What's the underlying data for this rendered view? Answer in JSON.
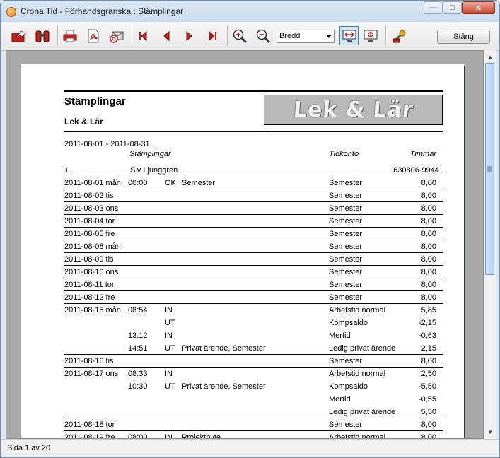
{
  "window": {
    "title": "Crona Tid - Förhandsgranska : Stämplingar"
  },
  "toolbar": {
    "zoom_value": "Bredd",
    "close_label": "Stäng"
  },
  "status": {
    "page_text": "Sida 1 av 20"
  },
  "colors": {
    "window_border": "#6f8fb4",
    "titlebar": "#c9dbef",
    "preview_bg": "#a8a8a8",
    "close_button": "#c9462c"
  },
  "report": {
    "title": "Stämplingar",
    "company": "Lek & Lär",
    "logo_text": "Lek & Lär",
    "period": "2011-08-01 - 2011-08-31",
    "headers": {
      "stamps": "Stämplingar",
      "account": "Tidkonto",
      "hours": "Timmar"
    },
    "employee": {
      "id": "1",
      "name": "Siv Ljunggren",
      "pnr": "630806-9944"
    },
    "rows": [
      {
        "date": "2011-08-01 mån",
        "time": "00:00",
        "type": "OK",
        "note": "Semester",
        "account": "Semester",
        "hours": "8,00",
        "line": true
      },
      {
        "date": "2011-08-02 tis",
        "time": "",
        "type": "",
        "note": "",
        "account": "Semester",
        "hours": "8,00",
        "line": true
      },
      {
        "date": "2011-08-03 ons",
        "time": "",
        "type": "",
        "note": "",
        "account": "Semester",
        "hours": "8,00",
        "line": true
      },
      {
        "date": "2011-08-04 tor",
        "time": "",
        "type": "",
        "note": "",
        "account": "Semester",
        "hours": "8,00",
        "line": true
      },
      {
        "date": "2011-08-05 fre",
        "time": "",
        "type": "",
        "note": "",
        "account": "Semester",
        "hours": "8,00",
        "line": true
      },
      {
        "date": "2011-08-08 mån",
        "time": "",
        "type": "",
        "note": "",
        "account": "Semester",
        "hours": "8,00",
        "line": true
      },
      {
        "date": "2011-08-09 tis",
        "time": "",
        "type": "",
        "note": "",
        "account": "Semester",
        "hours": "8,00",
        "line": true
      },
      {
        "date": "2011-08-10 ons",
        "time": "",
        "type": "",
        "note": "",
        "account": "Semester",
        "hours": "8,00",
        "line": true
      },
      {
        "date": "2011-08-11 tor",
        "time": "",
        "type": "",
        "note": "",
        "account": "Semester",
        "hours": "8,00",
        "line": true
      },
      {
        "date": "2011-08-12 fre",
        "time": "",
        "type": "",
        "note": "",
        "account": "Semester",
        "hours": "8,00",
        "line": true
      },
      {
        "date": "2011-08-15 mån",
        "time": "08:54",
        "type": "IN",
        "note": "",
        "account": "Arbetstid normal",
        "hours": "5,85",
        "line": false
      },
      {
        "date": "",
        "time": "",
        "type": "UT",
        "note": "",
        "account": "Kompsaldo",
        "hours": "-2,15",
        "line": false
      },
      {
        "date": "",
        "time": "13:12",
        "type": "IN",
        "note": "",
        "account": "Mertid",
        "hours": "-0,63",
        "line": false
      },
      {
        "date": "",
        "time": "14:51",
        "type": "UT",
        "note": "Privat ärende, Semester",
        "account": "Ledig privat ärende",
        "hours": "2,15",
        "line": true
      },
      {
        "date": "2011-08-16 tis",
        "time": "",
        "type": "",
        "note": "",
        "account": "Semester",
        "hours": "8,00",
        "line": true
      },
      {
        "date": "2011-08-17 ons",
        "time": "08:33",
        "type": "IN",
        "note": "",
        "account": "Arbetstid normal",
        "hours": "2,50",
        "line": false
      },
      {
        "date": "",
        "time": "10:30",
        "type": "UT",
        "note": "Privat ärende, Semester",
        "account": "Kompsaldo",
        "hours": "-5,50",
        "line": false
      },
      {
        "date": "",
        "time": "",
        "type": "",
        "note": "",
        "account": "Mertid",
        "hours": "-0,55",
        "line": false
      },
      {
        "date": "",
        "time": "",
        "type": "",
        "note": "",
        "account": "Ledig privat ärende",
        "hours": "5,50",
        "line": true
      },
      {
        "date": "2011-08-18 tor",
        "time": "",
        "type": "",
        "note": "",
        "account": "Semester",
        "hours": "8,00",
        "line": true
      },
      {
        "date": "2011-08-19 fre",
        "time": "08:00",
        "type": "IN",
        "note": "Projektbyte",
        "account": "Arbetstid normal",
        "hours": "8,00",
        "line": false
      }
    ]
  }
}
